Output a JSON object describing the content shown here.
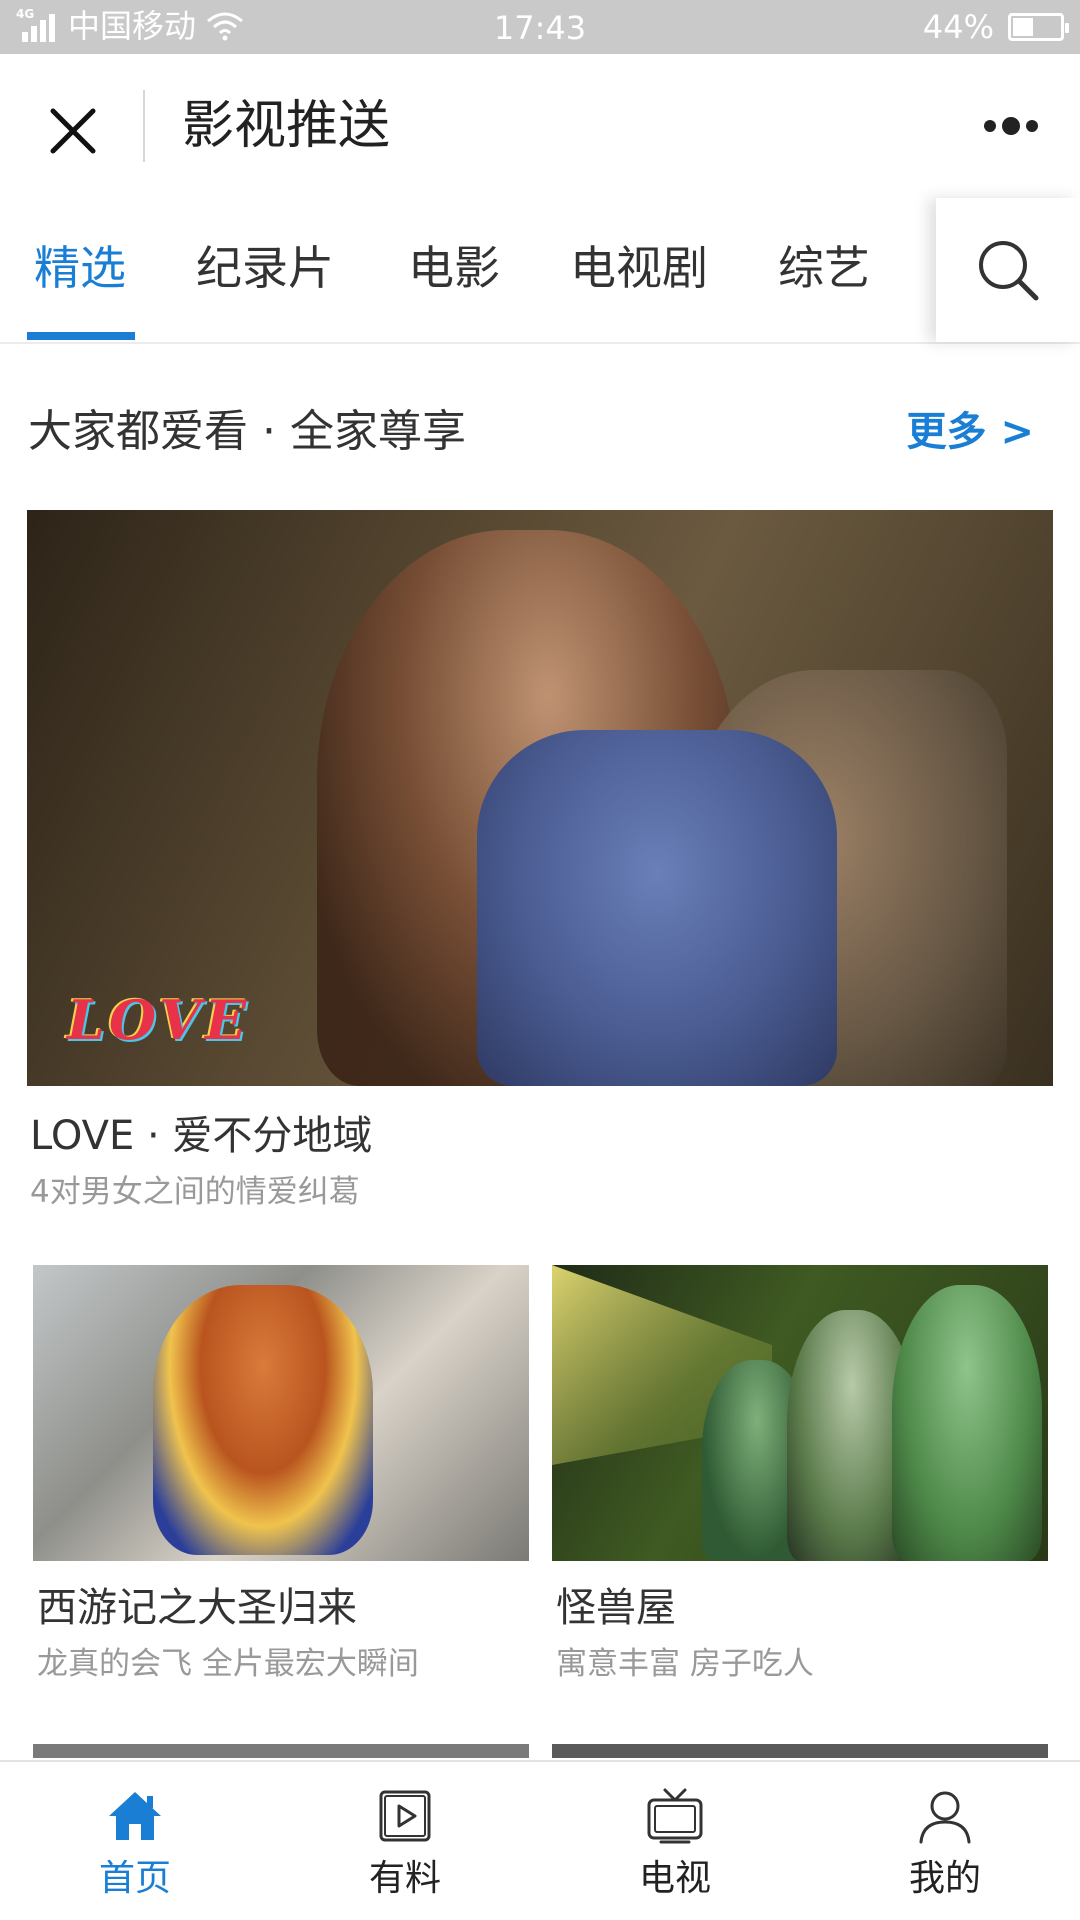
{
  "status_bar": {
    "network": "4G",
    "carrier": "中国移动",
    "time": "17:43",
    "battery_percent_text": "44%",
    "battery_level": 0.44
  },
  "navbar": {
    "title": "影视推送",
    "close_icon": "close-icon",
    "more_icon": "more-icon"
  },
  "tabs": {
    "items": [
      {
        "label": "精选",
        "active": true
      },
      {
        "label": "纪录片",
        "active": false
      },
      {
        "label": "电影",
        "active": false
      },
      {
        "label": "电视剧",
        "active": false
      },
      {
        "label": "综艺",
        "active": false
      }
    ],
    "search_icon": "search-icon"
  },
  "section": {
    "title": "大家都爱看 · 全家尊享",
    "more_label": "更多 >"
  },
  "featured": {
    "title": "LOVE · 爱不分地域",
    "subtitle": "4对男女之间的情爱纠葛",
    "poster_text": "LOVE"
  },
  "cards": [
    {
      "title": "西游记之大圣归来",
      "subtitle": "龙真的会飞 全片最宏大瞬间"
    },
    {
      "title": "怪兽屋",
      "subtitle": "寓意丰富 房子吃人"
    }
  ],
  "bottom_nav": [
    {
      "label": "首页",
      "icon": "home-icon",
      "active": true
    },
    {
      "label": "有料",
      "icon": "play-icon",
      "active": false
    },
    {
      "label": "电视",
      "icon": "tv-icon",
      "active": false
    },
    {
      "label": "我的",
      "icon": "user-icon",
      "active": false
    }
  ],
  "colors": {
    "accent": "#1a7fd4",
    "status_bar_bg": "#c9c9c9",
    "text_primary": "#333333",
    "text_secondary": "#999999"
  }
}
